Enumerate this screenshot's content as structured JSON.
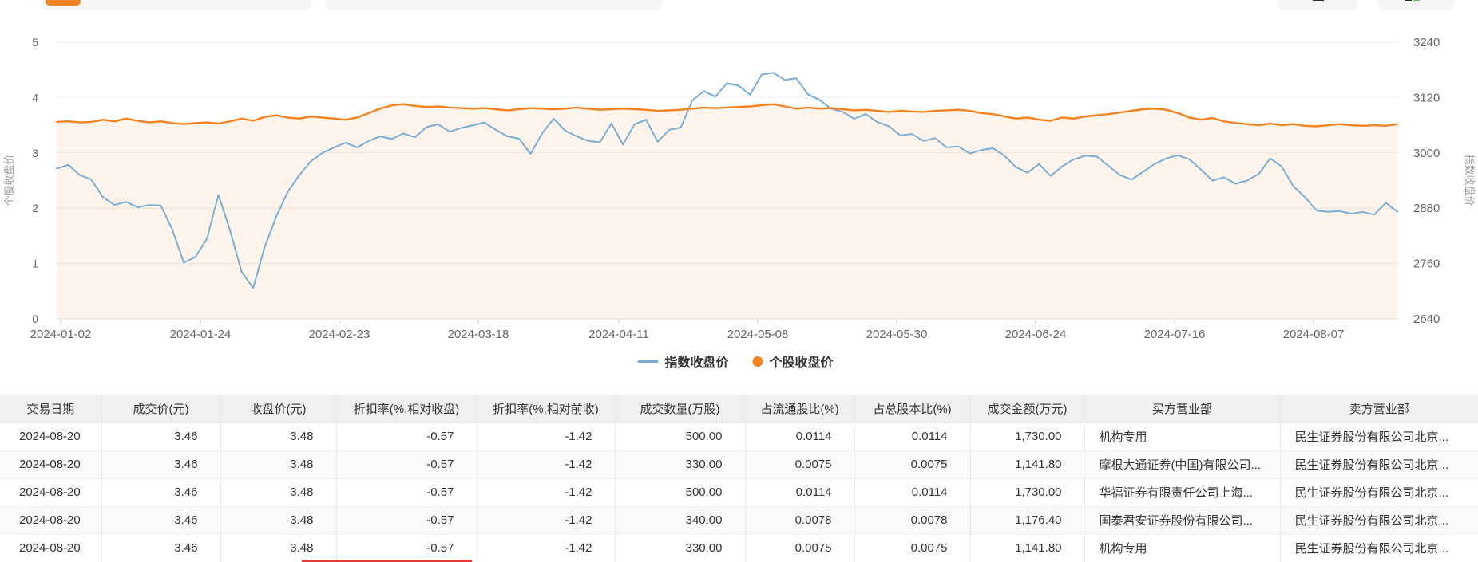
{
  "toolbar": {
    "active_tab_color": "#f5821f",
    "icon_buttons": [
      "grid-icon",
      "excel-export-icon"
    ]
  },
  "chart_data": {
    "type": "line",
    "title": "",
    "grid": true,
    "legend_position": "bottom",
    "legend": [
      {
        "label": "指数收盘价",
        "color": "#78aed6",
        "marker": "line"
      },
      {
        "label": "个股收盘价",
        "color": "#f5821f",
        "marker": "dot"
      }
    ],
    "left_axis": {
      "title": "个股收盘价",
      "min": 0,
      "max": 5,
      "ticks": [
        0,
        1,
        2,
        3,
        4,
        5
      ]
    },
    "right_axis": {
      "title": "指数收盘价",
      "min": 2640,
      "max": 3240,
      "ticks": [
        2640,
        2760,
        2880,
        3000,
        3120,
        3240
      ]
    },
    "x_labels": [
      "2024-01-02",
      "2024-01-24",
      "2024-02-23",
      "2024-03-18",
      "2024-04-11",
      "2024-05-08",
      "2024-05-30",
      "2024-06-24",
      "2024-07-16",
      "2024-08-07"
    ],
    "x_range": [
      "2024-01-02",
      "2024-08-20"
    ],
    "series": [
      {
        "name": "指数收盘价",
        "axis": "right",
        "color": "#78aed6",
        "values": [
          2966,
          2974,
          2952,
          2942,
          2904,
          2887,
          2894,
          2882,
          2887,
          2886,
          2834,
          2762,
          2774,
          2814,
          2909,
          2832,
          2742,
          2707,
          2796,
          2862,
          2916,
          2952,
          2982,
          3000,
          3012,
          3022,
          3012,
          3026,
          3036,
          3030,
          3042,
          3034,
          3056,
          3062,
          3046,
          3054,
          3060,
          3066,
          3050,
          3036,
          3031,
          2998,
          3042,
          3074,
          3048,
          3036,
          3026,
          3023,
          3064,
          3018,
          3062,
          3072,
          3024,
          3050,
          3055,
          3114,
          3134,
          3122,
          3151,
          3146,
          3126,
          3170,
          3174,
          3158,
          3162,
          3127,
          3115,
          3096,
          3089,
          3074,
          3084,
          3067,
          3058,
          3038,
          3041,
          3026,
          3032,
          3012,
          3014,
          2999,
          3006,
          3010,
          2994,
          2969,
          2957,
          2976,
          2950,
          2971,
          2986,
          2994,
          2992,
          2972,
          2952,
          2942,
          2959,
          2976,
          2988,
          2995,
          2986,
          2964,
          2940,
          2947,
          2933,
          2940,
          2954,
          2988,
          2970,
          2928,
          2904,
          2875,
          2872,
          2874,
          2868,
          2872,
          2866,
          2892,
          2872
        ]
      },
      {
        "name": "个股收盘价",
        "axis": "left",
        "color": "#f5821f",
        "fill": "rgba(245,130,31,0.09)",
        "values": [
          3.56,
          3.57,
          3.55,
          3.56,
          3.6,
          3.57,
          3.62,
          3.58,
          3.55,
          3.57,
          3.54,
          3.52,
          3.54,
          3.55,
          3.53,
          3.57,
          3.62,
          3.58,
          3.65,
          3.68,
          3.64,
          3.62,
          3.66,
          3.64,
          3.62,
          3.6,
          3.64,
          3.72,
          3.8,
          3.86,
          3.88,
          3.85,
          3.83,
          3.84,
          3.82,
          3.81,
          3.8,
          3.81,
          3.79,
          3.77,
          3.79,
          3.81,
          3.8,
          3.79,
          3.8,
          3.82,
          3.8,
          3.78,
          3.79,
          3.8,
          3.79,
          3.78,
          3.76,
          3.77,
          3.78,
          3.8,
          3.82,
          3.81,
          3.82,
          3.83,
          3.84,
          3.86,
          3.88,
          3.84,
          3.8,
          3.82,
          3.8,
          3.81,
          3.79,
          3.77,
          3.78,
          3.76,
          3.74,
          3.76,
          3.75,
          3.74,
          3.76,
          3.77,
          3.78,
          3.76,
          3.72,
          3.7,
          3.66,
          3.62,
          3.64,
          3.6,
          3.58,
          3.64,
          3.62,
          3.66,
          3.68,
          3.7,
          3.73,
          3.76,
          3.79,
          3.8,
          3.78,
          3.72,
          3.64,
          3.6,
          3.63,
          3.57,
          3.54,
          3.52,
          3.5,
          3.53,
          3.5,
          3.52,
          3.49,
          3.48,
          3.5,
          3.52,
          3.5,
          3.49,
          3.5,
          3.49,
          3.52
        ]
      }
    ]
  },
  "table": {
    "headers": [
      "交易日期",
      "成交价(元)",
      "收盘价(元)",
      "折扣率(%,相对收盘)",
      "折扣率(%,相对前收)",
      "成交数量(万股)",
      "占流通股比(%)",
      "占总股本比(%)",
      "成交金额(万元)",
      "买方营业部",
      "卖方营业部"
    ],
    "rows": [
      [
        "2024-08-20",
        "3.46",
        "3.48",
        "-0.57",
        "-1.42",
        "500.00",
        "0.0114",
        "0.0114",
        "1,730.00",
        "机构专用",
        "民生证券股份有限公司北京..."
      ],
      [
        "2024-08-20",
        "3.46",
        "3.48",
        "-0.57",
        "-1.42",
        "330.00",
        "0.0075",
        "0.0075",
        "1,141.80",
        "摩根大通证券(中国)有限公司...",
        "民生证券股份有限公司北京..."
      ],
      [
        "2024-08-20",
        "3.46",
        "3.48",
        "-0.57",
        "-1.42",
        "500.00",
        "0.0114",
        "0.0114",
        "1,730.00",
        "华福证券有限责任公司上海...",
        "民生证券股份有限公司北京..."
      ],
      [
        "2024-08-20",
        "3.46",
        "3.48",
        "-0.57",
        "-1.42",
        "340.00",
        "0.0078",
        "0.0078",
        "1,176.40",
        "国泰君安证券股份有限公司...",
        "民生证券股份有限公司北京..."
      ],
      [
        "2024-08-20",
        "3.46",
        "3.48",
        "-0.57",
        "-1.42",
        "330.00",
        "0.0075",
        "0.0075",
        "1,141.80",
        "机构专用",
        "民生证券股份有限公司北京..."
      ]
    ]
  }
}
